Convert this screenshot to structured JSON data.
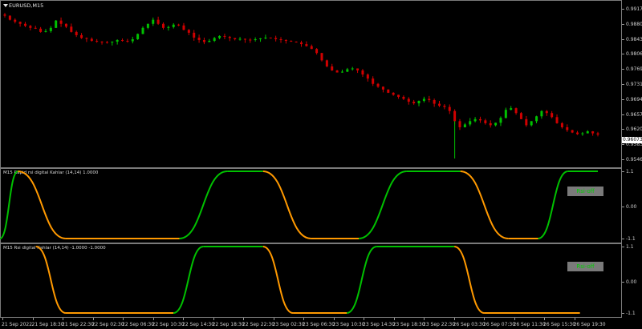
{
  "main_chart": {
    "symbol": "EURUSD,M15",
    "price_ticks": [
      "0.99170",
      "0.98800",
      "0.98430",
      "0.98060",
      "0.97690",
      "0.97310",
      "0.96940",
      "0.96570",
      "0.96200",
      "0.95830",
      "0.95460"
    ],
    "current_price": "0.96073",
    "colors": {
      "bull": "#00c000",
      "bear": "#d00000",
      "background": "#000000"
    }
  },
  "indicator1": {
    "label": "M15 Rapid rsi digital Kahlar (14,14) 1.0000",
    "ticks": [
      "1.1",
      "0.00",
      "-1.1"
    ],
    "button_label": "Rsi-off"
  },
  "indicator2": {
    "label": "M15 Rsi digital Kahlar (14,14) -1.0000 -1.0000",
    "ticks": [
      "1.1",
      "0.00",
      "-1.1"
    ],
    "button_label": "Rsi-off"
  },
  "time_axis": {
    "labels": [
      "21 Sep 2022",
      "21 Sep 18:30",
      "21 Sep 22:30",
      "22 Sep 02:30",
      "22 Sep 06:30",
      "22 Sep 10:30",
      "22 Sep 14:30",
      "22 Sep 18:30",
      "22 Sep 22:30",
      "23 Sep 02:30",
      "23 Sep 06:30",
      "23 Sep 10:30",
      "23 Sep 14:30",
      "23 Sep 18:30",
      "23 Sep 22:30",
      "26 Sep 03:30",
      "26 Sep 07:30",
      "26 Sep 11:30",
      "26 Sep 15:30",
      "26 Sep 19:30"
    ]
  },
  "chart_data": [
    {
      "type": "candlestick",
      "ylim": [
        0.9546,
        0.9917
      ],
      "close_path": [
        0.99,
        0.989,
        0.9885,
        0.988,
        0.9875,
        0.987,
        0.9868,
        0.986,
        0.9862,
        0.987,
        0.9888,
        0.988,
        0.9873,
        0.986,
        0.9852,
        0.9845,
        0.9843,
        0.9838,
        0.9836,
        0.9835,
        0.9834,
        0.9836,
        0.984,
        0.9838,
        0.9837,
        0.9842,
        0.9855,
        0.987,
        0.988,
        0.989,
        0.988,
        0.987,
        0.9872,
        0.9878,
        0.9876,
        0.9865,
        0.9858,
        0.9846,
        0.984,
        0.9835,
        0.9838,
        0.9845,
        0.985,
        0.9848,
        0.9845,
        0.9842,
        0.9843,
        0.9841,
        0.984,
        0.9842,
        0.9844,
        0.9846,
        0.9845,
        0.9842,
        0.984,
        0.9838,
        0.9836,
        0.9834,
        0.983,
        0.9825,
        0.9818,
        0.9808,
        0.979,
        0.9775,
        0.9765,
        0.976,
        0.9762,
        0.9768,
        0.977,
        0.9765,
        0.9755,
        0.9745,
        0.9732,
        0.9725,
        0.9718,
        0.971,
        0.9705,
        0.97,
        0.9695,
        0.9688,
        0.9684,
        0.969,
        0.9695,
        0.9692,
        0.9683,
        0.9678,
        0.9675,
        0.9665,
        0.964,
        0.9625,
        0.9632,
        0.964,
        0.9645,
        0.9642,
        0.9635,
        0.963,
        0.9636,
        0.9648,
        0.9668,
        0.9672,
        0.966,
        0.9645,
        0.963,
        0.964,
        0.9652,
        0.9665,
        0.966,
        0.965,
        0.9635,
        0.9625,
        0.9618,
        0.9612,
        0.9608,
        0.961,
        0.9615,
        0.961,
        0.9607
      ]
    },
    {
      "type": "line",
      "name": "M15 Rapid rsi digital Kahlar (14,14)",
      "ylim": [
        -1.1,
        1.1
      ],
      "segments": [
        {
          "color": "#00c000",
          "x_range": [
            0,
            0.03
          ],
          "from": -1.1,
          "to": 1.1
        },
        {
          "color": "#ff9900",
          "x_range": [
            0.03,
            0.11
          ],
          "from": 1.1,
          "to": -1.1
        },
        {
          "color": "#ff9900",
          "x_range": [
            0.11,
            0.3
          ],
          "from": -1.1,
          "to": -1.1
        },
        {
          "color": "#00c000",
          "x_range": [
            0.3,
            0.38
          ],
          "from": -1.1,
          "to": 1.1
        },
        {
          "color": "#00c000",
          "x_range": [
            0.38,
            0.44
          ],
          "from": 1.1,
          "to": 1.1
        },
        {
          "color": "#ff9900",
          "x_range": [
            0.44,
            0.52
          ],
          "from": 1.1,
          "to": -1.1
        },
        {
          "color": "#ff9900",
          "x_range": [
            0.52,
            0.6
          ],
          "from": -1.1,
          "to": -1.1
        },
        {
          "color": "#00c000",
          "x_range": [
            0.6,
            0.68
          ],
          "from": -1.1,
          "to": 1.1
        },
        {
          "color": "#00c000",
          "x_range": [
            0.68,
            0.77
          ],
          "from": 1.1,
          "to": 1.1
        },
        {
          "color": "#ff9900",
          "x_range": [
            0.77,
            0.85
          ],
          "from": 1.1,
          "to": -1.1
        },
        {
          "color": "#ff9900",
          "x_range": [
            0.85,
            0.9
          ],
          "from": -1.1,
          "to": -1.1
        },
        {
          "color": "#00c000",
          "x_range": [
            0.9,
            0.95
          ],
          "from": -1.1,
          "to": 1.1
        },
        {
          "color": "#00c000",
          "x_range": [
            0.95,
            1.0
          ],
          "from": 1.1,
          "to": 1.1
        }
      ]
    },
    {
      "type": "line",
      "name": "M15 Rsi digital Kahlar (14,14)",
      "ylim": [
        -1.1,
        1.1
      ],
      "segments": [
        {
          "color": "#ff9900",
          "x_range": [
            0.06,
            0.11
          ],
          "from": 1.1,
          "to": -1.1
        },
        {
          "color": "#ff9900",
          "x_range": [
            0.11,
            0.29
          ],
          "from": -1.1,
          "to": -1.1
        },
        {
          "color": "#00c000",
          "x_range": [
            0.29,
            0.34
          ],
          "from": -1.1,
          "to": 1.1
        },
        {
          "color": "#00c000",
          "x_range": [
            0.34,
            0.44
          ],
          "from": 1.1,
          "to": 1.1
        },
        {
          "color": "#ff9900",
          "x_range": [
            0.44,
            0.49
          ],
          "from": 1.1,
          "to": -1.1
        },
        {
          "color": "#ff9900",
          "x_range": [
            0.49,
            0.58
          ],
          "from": -1.1,
          "to": -1.1
        },
        {
          "color": "#00c000",
          "x_range": [
            0.58,
            0.63
          ],
          "from": -1.1,
          "to": 1.1
        },
        {
          "color": "#00c000",
          "x_range": [
            0.63,
            0.76
          ],
          "from": 1.1,
          "to": 1.1
        },
        {
          "color": "#ff9900",
          "x_range": [
            0.76,
            0.81
          ],
          "from": 1.1,
          "to": -1.1
        },
        {
          "color": "#ff9900",
          "x_range": [
            0.81,
            0.97
          ],
          "from": -1.1,
          "to": -1.1
        }
      ]
    }
  ]
}
